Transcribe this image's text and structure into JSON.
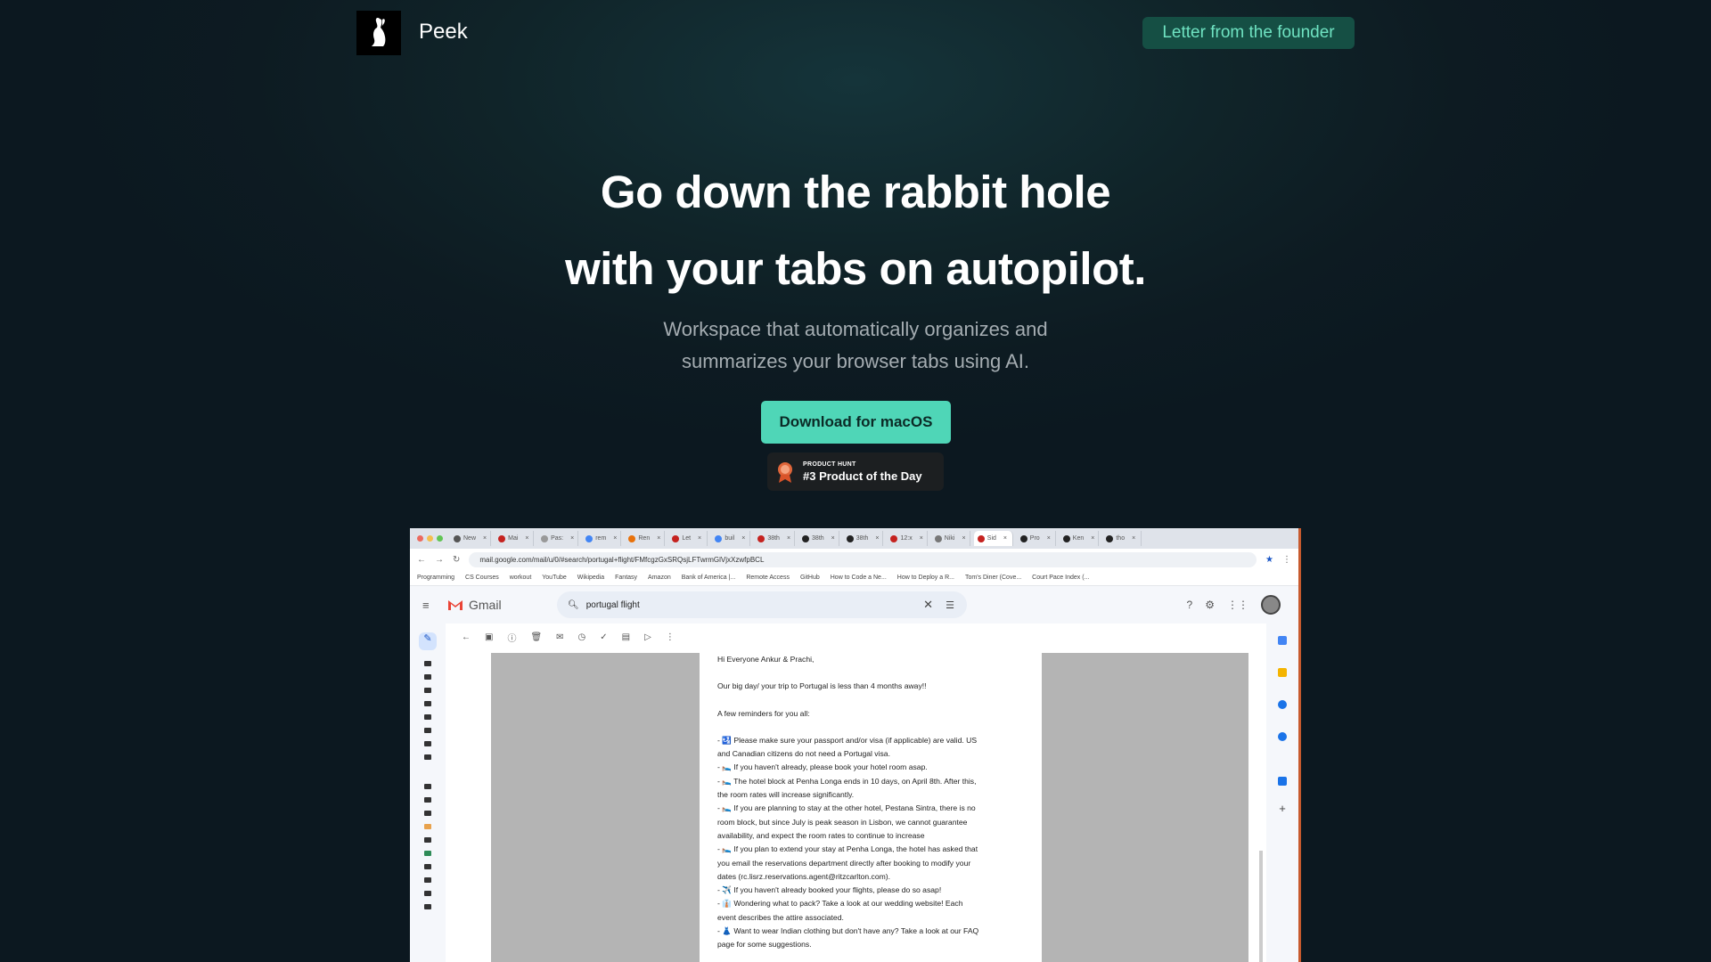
{
  "header": {
    "brand": "Peek",
    "founder_button": "Letter from the founder"
  },
  "hero": {
    "title_line1": "Go down the rabbit hole",
    "title_line2": "with your tabs on autopilot.",
    "subtitle_line1": "Workspace that automatically organizes and",
    "subtitle_line2": "summarizes your browser tabs using AI.",
    "download_button": "Download for macOS",
    "badge_small": "PRODUCT HUNT",
    "badge_big": "#3 Product of the Day"
  },
  "screenshot": {
    "tabs": [
      "New",
      "Mai",
      "Pas:",
      "rem",
      "Ren",
      "Let",
      "buil",
      "38th",
      "38th",
      "38th",
      "12:x",
      "Niki",
      "Sid",
      "Pro",
      "Ken",
      "tho"
    ],
    "url": "mail.google.com/mail/u/0/#search/portugal+flight/FMfcgzGxSRQsjLFTwrmGlVjxXzwfpBCL",
    "bookmarks": [
      "Programming",
      "CS Courses",
      "workout",
      "YouTube",
      "Wikipedia",
      "Fantasy",
      "Amazon",
      "Bank of America |...",
      "Remote Access",
      "GitHub",
      "How to Code a Ne...",
      "How to Deploy a R...",
      "Tom's Diner (Cove...",
      "Court Pace Index (..."
    ],
    "gmail_brand": "Gmail",
    "search_query": "portugal flight",
    "email_lines": [
      "Hi Everyone Ankur & Prachi,",
      "",
      "Our big day/ your trip to Portugal is less than 4 months away!!",
      "",
      "A few reminders for you all:",
      "",
      "- 🛂 Please make sure your passport and/or visa (if applicable) are valid. US",
      "and Canadian citizens do not need a Portugal visa.",
      "- 🛌 If you haven't already, please book your hotel room asap.",
      "- 🛌 The hotel block at Penha Longa ends in 10 days, on April 8th. After this,",
      "the room rates will increase significantly.",
      "- 🛌 If you are planning to stay at the other hotel, Pestana Sintra, there is no",
      "room block, but since July is peak season in Lisbon, we cannot guarantee",
      "availability, and expect the room rates to continue to increase",
      "- 🛌 If you plan to extend your stay at Penha Longa, the hotel has asked that",
      "you email the reservations department directly after booking to modify your",
      "dates (rc.lisrz.reservations.agent@ritzcarlton.com).",
      "- ✈️ If you haven't already booked your flights, please do so asap!",
      "- 👔 Wondering what to pack? Take a look at our wedding website! Each",
      "event describes the attire associated.",
      "- 👗 Want to wear Indian clothing but don't have any? Take a look at our FAQ",
      "page for some suggestions."
    ]
  }
}
